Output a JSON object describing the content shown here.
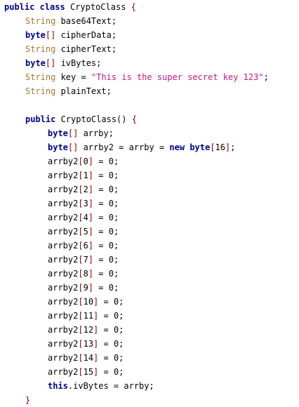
{
  "lines": [
    {
      "indent": 0,
      "tokens": [
        {
          "t": "kw",
          "v": "public"
        },
        {
          "t": "plain",
          "v": " "
        },
        {
          "t": "kw",
          "v": "class"
        },
        {
          "t": "plain",
          "v": " CryptoClass "
        },
        {
          "t": "punct",
          "v": "{"
        }
      ]
    },
    {
      "indent": 1,
      "tokens": [
        {
          "t": "type",
          "v": "String"
        },
        {
          "t": "plain",
          "v": " base64Text;"
        }
      ]
    },
    {
      "indent": 1,
      "tokens": [
        {
          "t": "kwtype",
          "v": "byte"
        },
        {
          "t": "punct",
          "v": "[]"
        },
        {
          "t": "plain",
          "v": " cipherData;"
        }
      ]
    },
    {
      "indent": 1,
      "tokens": [
        {
          "t": "type",
          "v": "String"
        },
        {
          "t": "plain",
          "v": " cipherText;"
        }
      ]
    },
    {
      "indent": 1,
      "tokens": [
        {
          "t": "kwtype",
          "v": "byte"
        },
        {
          "t": "punct",
          "v": "[]"
        },
        {
          "t": "plain",
          "v": " ivBytes;"
        }
      ]
    },
    {
      "indent": 1,
      "tokens": [
        {
          "t": "type",
          "v": "String"
        },
        {
          "t": "plain",
          "v": " key = "
        },
        {
          "t": "str",
          "v": "\"This is the super secret key 123\""
        },
        {
          "t": "plain",
          "v": ";"
        }
      ]
    },
    {
      "indent": 1,
      "tokens": [
        {
          "t": "type",
          "v": "String"
        },
        {
          "t": "plain",
          "v": " plainText;"
        }
      ]
    },
    {
      "indent": 0,
      "tokens": []
    },
    {
      "indent": 1,
      "tokens": [
        {
          "t": "kw",
          "v": "public"
        },
        {
          "t": "plain",
          "v": " CryptoClass() "
        },
        {
          "t": "punct",
          "v": "{"
        }
      ]
    },
    {
      "indent": 2,
      "tokens": [
        {
          "t": "kwtype",
          "v": "byte"
        },
        {
          "t": "punct",
          "v": "[]"
        },
        {
          "t": "plain",
          "v": " arrby;"
        }
      ]
    },
    {
      "indent": 2,
      "tokens": [
        {
          "t": "kwtype",
          "v": "byte"
        },
        {
          "t": "punct",
          "v": "[]"
        },
        {
          "t": "plain",
          "v": " arrby2 = arrby = "
        },
        {
          "t": "kw",
          "v": "new"
        },
        {
          "t": "plain",
          "v": " "
        },
        {
          "t": "kwtype",
          "v": "byte"
        },
        {
          "t": "punct",
          "v": "["
        },
        {
          "t": "plain",
          "v": "16"
        },
        {
          "t": "punct",
          "v": "]"
        },
        {
          "t": "plain",
          "v": ";"
        }
      ]
    },
    {
      "indent": 2,
      "tokens": [
        {
          "t": "plain",
          "v": "arrby2"
        },
        {
          "t": "punct",
          "v": "["
        },
        {
          "t": "plain",
          "v": "0"
        },
        {
          "t": "punct",
          "v": "]"
        },
        {
          "t": "plain",
          "v": " = 0;"
        }
      ]
    },
    {
      "indent": 2,
      "tokens": [
        {
          "t": "plain",
          "v": "arrby2"
        },
        {
          "t": "punct",
          "v": "["
        },
        {
          "t": "plain",
          "v": "1"
        },
        {
          "t": "punct",
          "v": "]"
        },
        {
          "t": "plain",
          "v": " = 0;"
        }
      ]
    },
    {
      "indent": 2,
      "tokens": [
        {
          "t": "plain",
          "v": "arrby2"
        },
        {
          "t": "punct",
          "v": "["
        },
        {
          "t": "plain",
          "v": "2"
        },
        {
          "t": "punct",
          "v": "]"
        },
        {
          "t": "plain",
          "v": " = 0;"
        }
      ]
    },
    {
      "indent": 2,
      "tokens": [
        {
          "t": "plain",
          "v": "arrby2"
        },
        {
          "t": "punct",
          "v": "["
        },
        {
          "t": "plain",
          "v": "3"
        },
        {
          "t": "punct",
          "v": "]"
        },
        {
          "t": "plain",
          "v": " = 0;"
        }
      ]
    },
    {
      "indent": 2,
      "tokens": [
        {
          "t": "plain",
          "v": "arrby2"
        },
        {
          "t": "punct",
          "v": "["
        },
        {
          "t": "plain",
          "v": "4"
        },
        {
          "t": "punct",
          "v": "]"
        },
        {
          "t": "plain",
          "v": " = 0;"
        }
      ]
    },
    {
      "indent": 2,
      "tokens": [
        {
          "t": "plain",
          "v": "arrby2"
        },
        {
          "t": "punct",
          "v": "["
        },
        {
          "t": "plain",
          "v": "5"
        },
        {
          "t": "punct",
          "v": "]"
        },
        {
          "t": "plain",
          "v": " = 0;"
        }
      ]
    },
    {
      "indent": 2,
      "tokens": [
        {
          "t": "plain",
          "v": "arrby2"
        },
        {
          "t": "punct",
          "v": "["
        },
        {
          "t": "plain",
          "v": "6"
        },
        {
          "t": "punct",
          "v": "]"
        },
        {
          "t": "plain",
          "v": " = 0;"
        }
      ]
    },
    {
      "indent": 2,
      "tokens": [
        {
          "t": "plain",
          "v": "arrby2"
        },
        {
          "t": "punct",
          "v": "["
        },
        {
          "t": "plain",
          "v": "7"
        },
        {
          "t": "punct",
          "v": "]"
        },
        {
          "t": "plain",
          "v": " = 0;"
        }
      ]
    },
    {
      "indent": 2,
      "tokens": [
        {
          "t": "plain",
          "v": "arrby2"
        },
        {
          "t": "punct",
          "v": "["
        },
        {
          "t": "plain",
          "v": "8"
        },
        {
          "t": "punct",
          "v": "]"
        },
        {
          "t": "plain",
          "v": " = 0;"
        }
      ]
    },
    {
      "indent": 2,
      "tokens": [
        {
          "t": "plain",
          "v": "arrby2"
        },
        {
          "t": "punct",
          "v": "["
        },
        {
          "t": "plain",
          "v": "9"
        },
        {
          "t": "punct",
          "v": "]"
        },
        {
          "t": "plain",
          "v": " = 0;"
        }
      ]
    },
    {
      "indent": 2,
      "tokens": [
        {
          "t": "plain",
          "v": "arrby2"
        },
        {
          "t": "punct",
          "v": "["
        },
        {
          "t": "plain",
          "v": "10"
        },
        {
          "t": "punct",
          "v": "]"
        },
        {
          "t": "plain",
          "v": " = 0;"
        }
      ]
    },
    {
      "indent": 2,
      "tokens": [
        {
          "t": "plain",
          "v": "arrby2"
        },
        {
          "t": "punct",
          "v": "["
        },
        {
          "t": "plain",
          "v": "11"
        },
        {
          "t": "punct",
          "v": "]"
        },
        {
          "t": "plain",
          "v": " = 0;"
        }
      ]
    },
    {
      "indent": 2,
      "tokens": [
        {
          "t": "plain",
          "v": "arrby2"
        },
        {
          "t": "punct",
          "v": "["
        },
        {
          "t": "plain",
          "v": "12"
        },
        {
          "t": "punct",
          "v": "]"
        },
        {
          "t": "plain",
          "v": " = 0;"
        }
      ]
    },
    {
      "indent": 2,
      "tokens": [
        {
          "t": "plain",
          "v": "arrby2"
        },
        {
          "t": "punct",
          "v": "["
        },
        {
          "t": "plain",
          "v": "13"
        },
        {
          "t": "punct",
          "v": "]"
        },
        {
          "t": "plain",
          "v": " = 0;"
        }
      ]
    },
    {
      "indent": 2,
      "tokens": [
        {
          "t": "plain",
          "v": "arrby2"
        },
        {
          "t": "punct",
          "v": "["
        },
        {
          "t": "plain",
          "v": "14"
        },
        {
          "t": "punct",
          "v": "]"
        },
        {
          "t": "plain",
          "v": " = 0;"
        }
      ]
    },
    {
      "indent": 2,
      "tokens": [
        {
          "t": "plain",
          "v": "arrby2"
        },
        {
          "t": "punct",
          "v": "["
        },
        {
          "t": "plain",
          "v": "15"
        },
        {
          "t": "punct",
          "v": "]"
        },
        {
          "t": "plain",
          "v": " = 0;"
        }
      ]
    },
    {
      "indent": 2,
      "tokens": [
        {
          "t": "this",
          "v": "this"
        },
        {
          "t": "plain",
          "v": ".ivBytes = arrby;"
        }
      ]
    },
    {
      "indent": 1,
      "tokens": [
        {
          "t": "punct",
          "v": "}"
        }
      ]
    }
  ]
}
